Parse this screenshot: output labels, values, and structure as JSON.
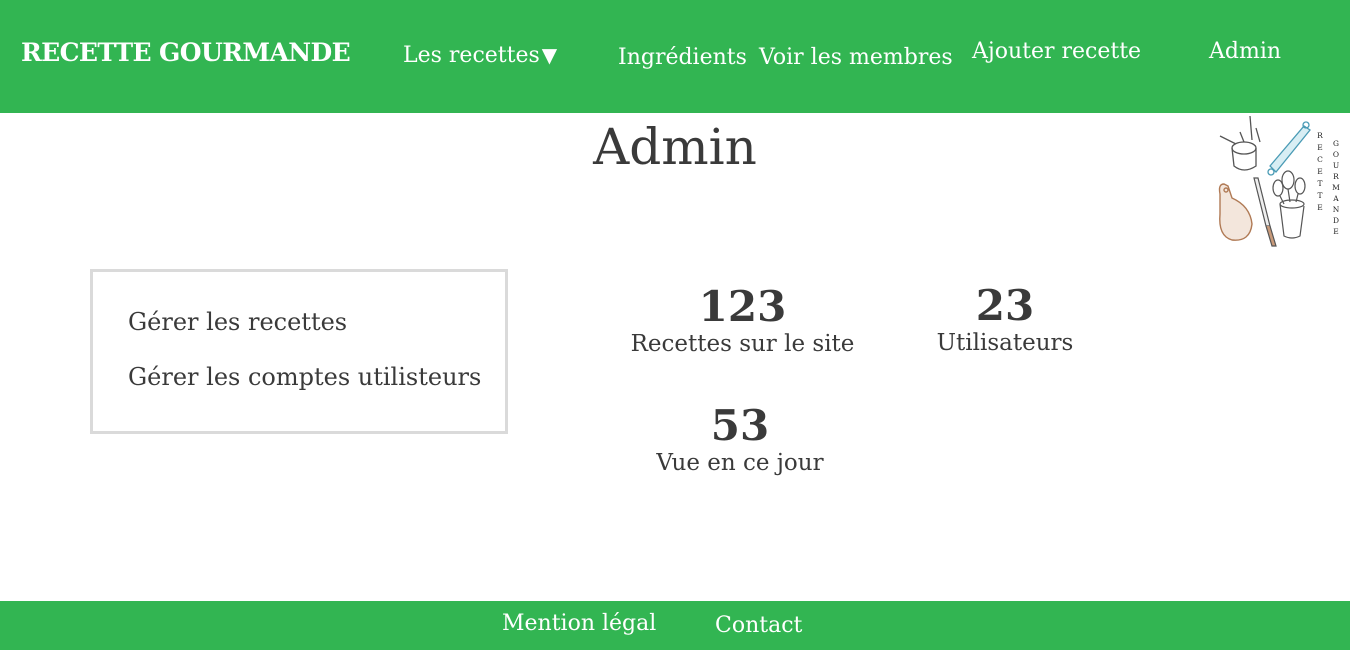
{
  "header": {
    "brand": "RECETTE GOURMANDE",
    "nav": {
      "recettes": "Les recettes",
      "ingredients": "Ingrédients",
      "membres": "Voir les membres",
      "ajouter": "Ajouter recette",
      "admin": "Admin"
    },
    "caret": "▼"
  },
  "main": {
    "title": "Admin",
    "logo": {
      "word1": "RECETTE",
      "word2": "GOURMANDE"
    },
    "admin_menu": {
      "manage_recipes": "Gérer les recettes",
      "manage_accounts": "Gérer les comptes utilisteurs"
    },
    "stats": {
      "recipes": {
        "value": "123",
        "label": "Recettes sur le site"
      },
      "users": {
        "value": "23",
        "label": "Utilisateurs"
      },
      "views": {
        "value": "53",
        "label": "Vue en ce jour"
      }
    }
  },
  "footer": {
    "mention": "Mention légal",
    "contact": "Contact"
  },
  "colors": {
    "brand_green": "#32b552",
    "text_dark": "#3a3a3a",
    "box_border": "#dadada"
  },
  "icons": {
    "logo": "kitchen-utensils-illustration"
  }
}
